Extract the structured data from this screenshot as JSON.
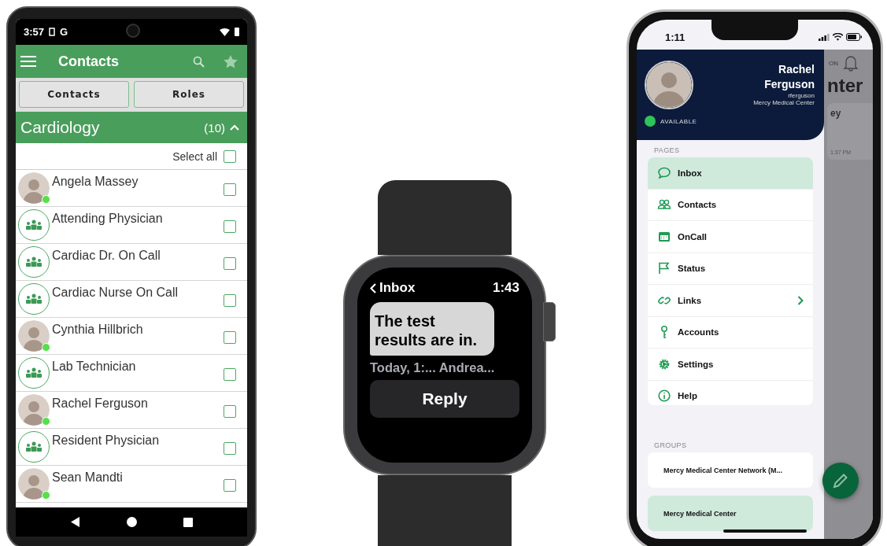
{
  "android_phone": {
    "status_bar": {
      "time": "3:57",
      "carrier": "G"
    },
    "app_bar": {
      "title": "Contacts"
    },
    "tabs": [
      {
        "label": "Contacts"
      },
      {
        "label": "Roles"
      }
    ],
    "section": {
      "title": "Cardiology",
      "count": "(10)",
      "expanded": true
    },
    "select_all": {
      "label": "Select all",
      "checked": false
    },
    "contacts": [
      {
        "name": "Angela Massey",
        "kind": "person",
        "online": true,
        "checked": false
      },
      {
        "name": "Attending Physician",
        "kind": "role",
        "checked": false
      },
      {
        "name": "Cardiac Dr. On Call",
        "kind": "role",
        "checked": false
      },
      {
        "name": "Cardiac Nurse On Call",
        "kind": "role",
        "checked": false
      },
      {
        "name": "Cynthia Hillbrich",
        "kind": "person",
        "online": true,
        "checked": false
      },
      {
        "name": "Lab Technician",
        "kind": "role",
        "checked": false
      },
      {
        "name": "Rachel Ferguson",
        "kind": "person",
        "online": true,
        "checked": false
      },
      {
        "name": "Resident Physician",
        "kind": "role",
        "checked": false
      },
      {
        "name": "Sean Mandti",
        "kind": "person",
        "online": true,
        "checked": false
      }
    ]
  },
  "watch": {
    "back_label": "Inbox",
    "time": "1:43",
    "message": "The test results are in.",
    "meta": "Today, 1:... Andrea...",
    "reply_button": "Reply"
  },
  "iphone": {
    "status_bar": {
      "time": "1:11"
    },
    "profile": {
      "name": "Rachel Ferguson",
      "username": "rferguson",
      "organization": "Mercy Medical Center",
      "status": "AVAILABLE"
    },
    "pages_heading": "PAGES",
    "pages": [
      {
        "label": "Inbox",
        "kind": "chat",
        "selected": true,
        "has_submenu": false
      },
      {
        "label": "Contacts",
        "kind": "people",
        "selected": false,
        "has_submenu": false
      },
      {
        "label": "OnCall",
        "kind": "calendar",
        "selected": false,
        "has_submenu": false
      },
      {
        "label": "Status",
        "kind": "flag",
        "selected": false,
        "has_submenu": false
      },
      {
        "label": "Links",
        "kind": "link",
        "selected": false,
        "has_submenu": true
      },
      {
        "label": "Accounts",
        "kind": "key",
        "selected": false,
        "has_submenu": false
      },
      {
        "label": "Settings",
        "kind": "gear",
        "selected": false,
        "has_submenu": false
      },
      {
        "label": "Help",
        "kind": "info",
        "selected": false,
        "has_submenu": false
      }
    ],
    "groups_heading": "GROUPS",
    "groups": [
      {
        "name": "Mercy Medical Center Network (M...",
        "selected": false
      },
      {
        "name": "Mercy Medical Center",
        "selected": true
      }
    ],
    "background": {
      "label": "ON",
      "title": "nter",
      "card_name": "ey",
      "card_time": "1:37 PM"
    }
  }
}
